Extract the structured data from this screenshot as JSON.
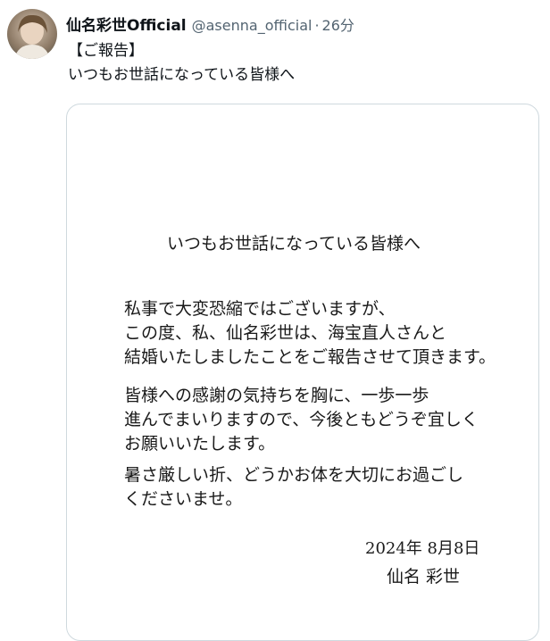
{
  "tweet": {
    "display_name": "仙名彩世Official",
    "handle": "@asenna_official",
    "separator": "·",
    "time": "26分",
    "text_lines": [
      "【ご報告】",
      "いつもお世話になっている皆様へ"
    ]
  },
  "letter": {
    "title": "いつもお世話になっている皆様へ",
    "paragraph_1": [
      "私事で大変恐縮ではございますが、",
      "この度、私、仙名彩世は、海宝直人さんと",
      "結婚いたしましたことをご報告させて頂きます。"
    ],
    "paragraph_2": [
      "皆様への感謝の気持ちを胸に、一歩一歩",
      "進んでまいりますので、今後ともどうぞ宜しく",
      "お願いいたします。"
    ],
    "paragraph_3": [
      "暑さ厳しい折、どうかお体を大切にお過ごし",
      "くださいませ。"
    ],
    "date": "2024年 8月8日",
    "signature": "仙名 彩世"
  },
  "colors": {
    "text_primary": "#0f1419",
    "text_secondary": "#536471",
    "card_border": "#cfd9de",
    "ink": "#1a1a1a"
  }
}
